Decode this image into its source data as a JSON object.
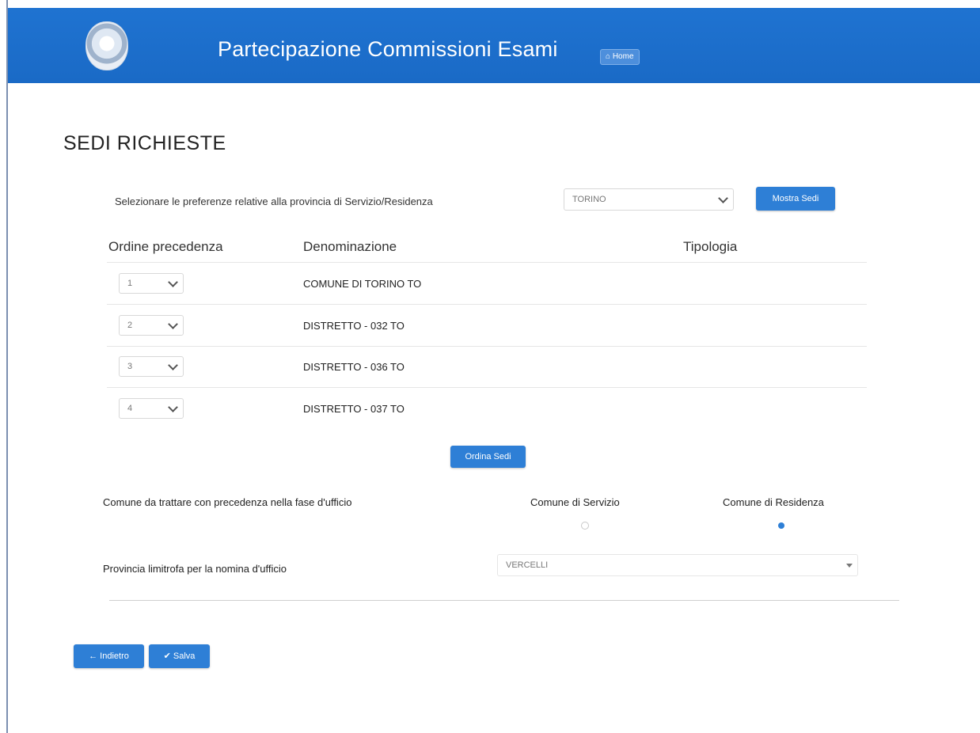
{
  "header": {
    "app_title": "Partecipazione Commissioni Esami",
    "home_label": "Home"
  },
  "page": {
    "title": "SEDI RICHIESTE"
  },
  "preferences": {
    "label": "Selezionare le preferenze relative alla provincia di Servizio/Residenza",
    "province_value": "TORINO",
    "show_button": "Mostra Sedi"
  },
  "table": {
    "headers": [
      "Ordine precedenza",
      "Denominazione",
      "Tipologia"
    ],
    "rows": [
      {
        "order": "1",
        "name": "COMUNE DI TORINO TO",
        "type": ""
      },
      {
        "order": "2",
        "name": "DISTRETTO - 032 TO",
        "type": ""
      },
      {
        "order": "3",
        "name": "DISTRETTO - 036 TO",
        "type": ""
      },
      {
        "order": "4",
        "name": "DISTRETTO - 037 TO",
        "type": ""
      }
    ]
  },
  "order_button": "Ordina Sedi",
  "priority": {
    "label": "Comune da trattare con precedenza nella fase d'ufficio",
    "option_service": "Comune di Servizio",
    "option_residence": "Comune di Residenza",
    "selected": "Comune di Residenza"
  },
  "neighbor": {
    "label": "Provincia limitrofa per la nomina d'ufficio",
    "value": "VERCELLI"
  },
  "footer": {
    "back_button": "Indietro",
    "save_button": "Salva"
  },
  "colors": {
    "header_blue": "#1f73d1",
    "button_blue": "#2e7fd6"
  }
}
